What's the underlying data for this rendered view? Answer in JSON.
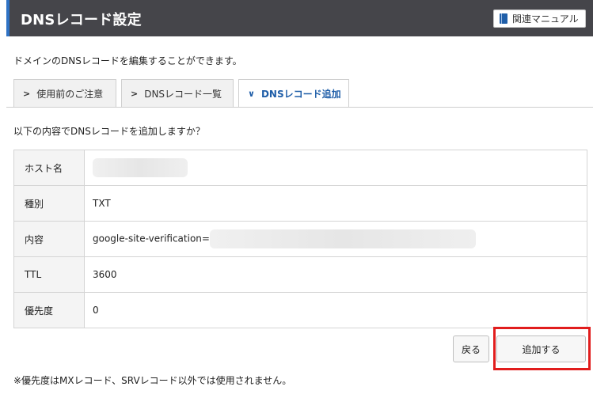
{
  "header": {
    "title": "DNSレコード設定",
    "manual_label": "関連マニュアル"
  },
  "description": "ドメインのDNSレコードを編集することができます。",
  "tabs": [
    {
      "label": "使用前のご注意",
      "active": false
    },
    {
      "label": "DNSレコード一覧",
      "active": false
    },
    {
      "label": "DNSレコード追加",
      "active": true
    }
  ],
  "confirm_question": "以下の内容でDNSレコードを追加しますか？",
  "record": {
    "host_label": "ホスト名",
    "host_value": "",
    "type_label": "種別",
    "type_value": "TXT",
    "content_label": "内容",
    "content_value": "google-site-verification=",
    "ttl_label": "TTL",
    "ttl_value": "3600",
    "priority_label": "優先度",
    "priority_value": "0"
  },
  "buttons": {
    "back_label": "戻る",
    "add_label": "追加する"
  },
  "note": "※優先度はMXレコード、SRVレコード以外では使用されません。",
  "colors": {
    "header_bg": "#45454a",
    "accent": "#2f72c4",
    "active_tab_text": "#1f5ea8",
    "highlight": "#e11d1d"
  }
}
